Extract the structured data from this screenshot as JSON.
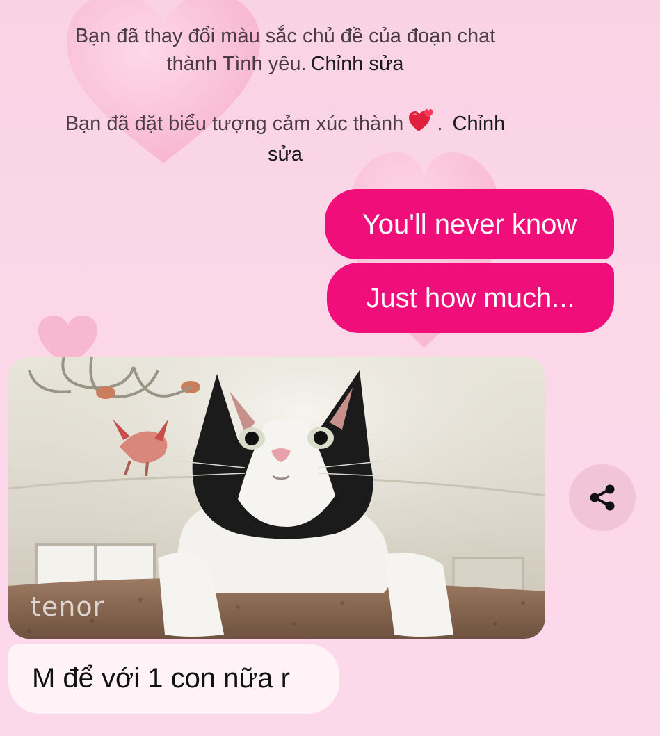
{
  "system_messages": [
    {
      "lines": [
        "Bạn đã thay đổi màu sắc chủ đề của đoạn chat",
        "thành Tình yêu."
      ],
      "edit_label": "Chỉnh sửa"
    },
    {
      "line1_prefix": "Bạn đã đặt biểu tượng cảm xúc thành",
      "emoji_icon": "heart-ribbon-emoji",
      "line1_suffix": ".",
      "edit_label_part1": "Chỉnh",
      "edit_label_part2": "sửa"
    }
  ],
  "outgoing_messages": [
    {
      "text": "You'll never know"
    },
    {
      "text": "Just how much..."
    }
  ],
  "gif": {
    "watermark": "tenor",
    "subject_icon": "surprised-cat-gif"
  },
  "share_button": {
    "icon": "share-icon"
  },
  "incoming_messages": [
    {
      "text": "M để với 1 con nữa r"
    }
  ],
  "colors": {
    "outgoing_bubble": "#f00f7a",
    "incoming_bubble": "#fff3f8",
    "background": "#fbd7e8",
    "share_button_bg": "#f2c4d8"
  }
}
